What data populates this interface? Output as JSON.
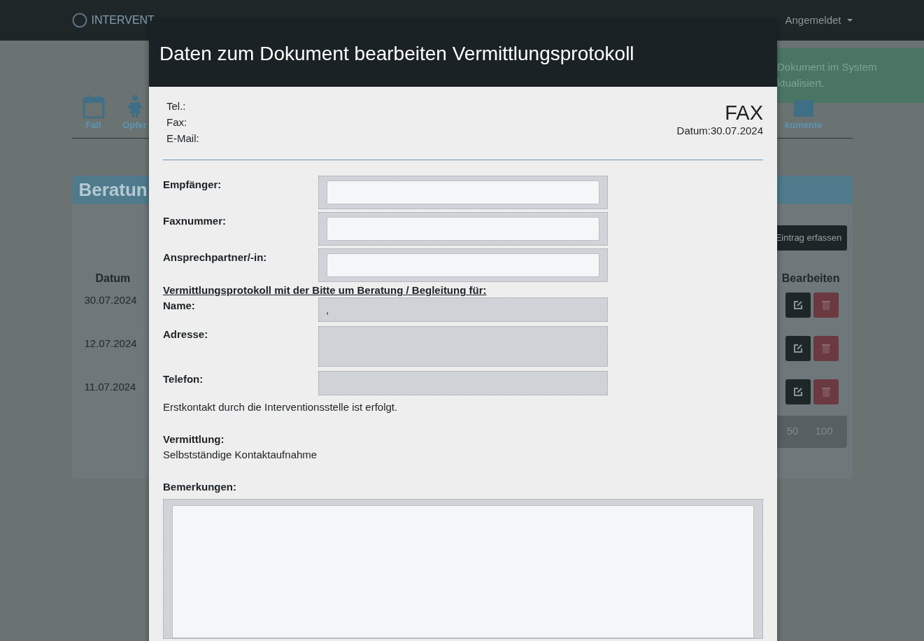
{
  "navbar": {
    "brand": "INTERVENT",
    "user_menu": {
      "label": "Angemeldet",
      "dropdown": true
    }
  },
  "alert": {
    "lines": [
      "Dokument im System",
      "ktualisiert."
    ]
  },
  "tabs": [
    {
      "label": "Fall"
    },
    {
      "label": "Opfer"
    },
    {
      "label": "kumente"
    }
  ],
  "panel": {
    "title": "Beratun",
    "add_button": "Eintrag erfassen",
    "columns": [
      "Datum",
      "Bearbeiten"
    ],
    "rows": [
      {
        "date": "30.07.2024"
      },
      {
        "date": "12.07.2024"
      },
      {
        "date": "11.07.2024"
      }
    ],
    "page_sizes": [
      "50",
      "100"
    ]
  },
  "modal": {
    "title": "Daten zum Dokument bearbeiten Vermittlungsprotokoll",
    "contact_lines": [
      "Tel.:",
      "Fax:",
      "E-Mail:"
    ],
    "doc_type": "FAX",
    "date": "Datum:30.07.2024",
    "fields": [
      {
        "label": "Empfänger:",
        "kind": "input"
      },
      {
        "label": "Faxnummer:",
        "kind": "input"
      },
      {
        "label": "Ansprechpartner/-in:",
        "kind": "input"
      }
    ],
    "section_heading": "Vermittlungsprotokoll mit der Bitte um Beratung / Begleitung für:",
    "info": [
      {
        "label": "Name:",
        "value": ",",
        "kind": "short"
      },
      {
        "label": "Adresse:",
        "kind": "tall"
      },
      {
        "label": "Telefon:",
        "kind": "short"
      }
    ],
    "statement": "Erstkontakt durch die Interventionsstelle ist erfolgt.",
    "vermittlung_label": "Vermittlung:",
    "vermittlung_value": "Selbstständige Kontaktaufnahme",
    "remarks_label": "Bemerkungen:"
  }
}
